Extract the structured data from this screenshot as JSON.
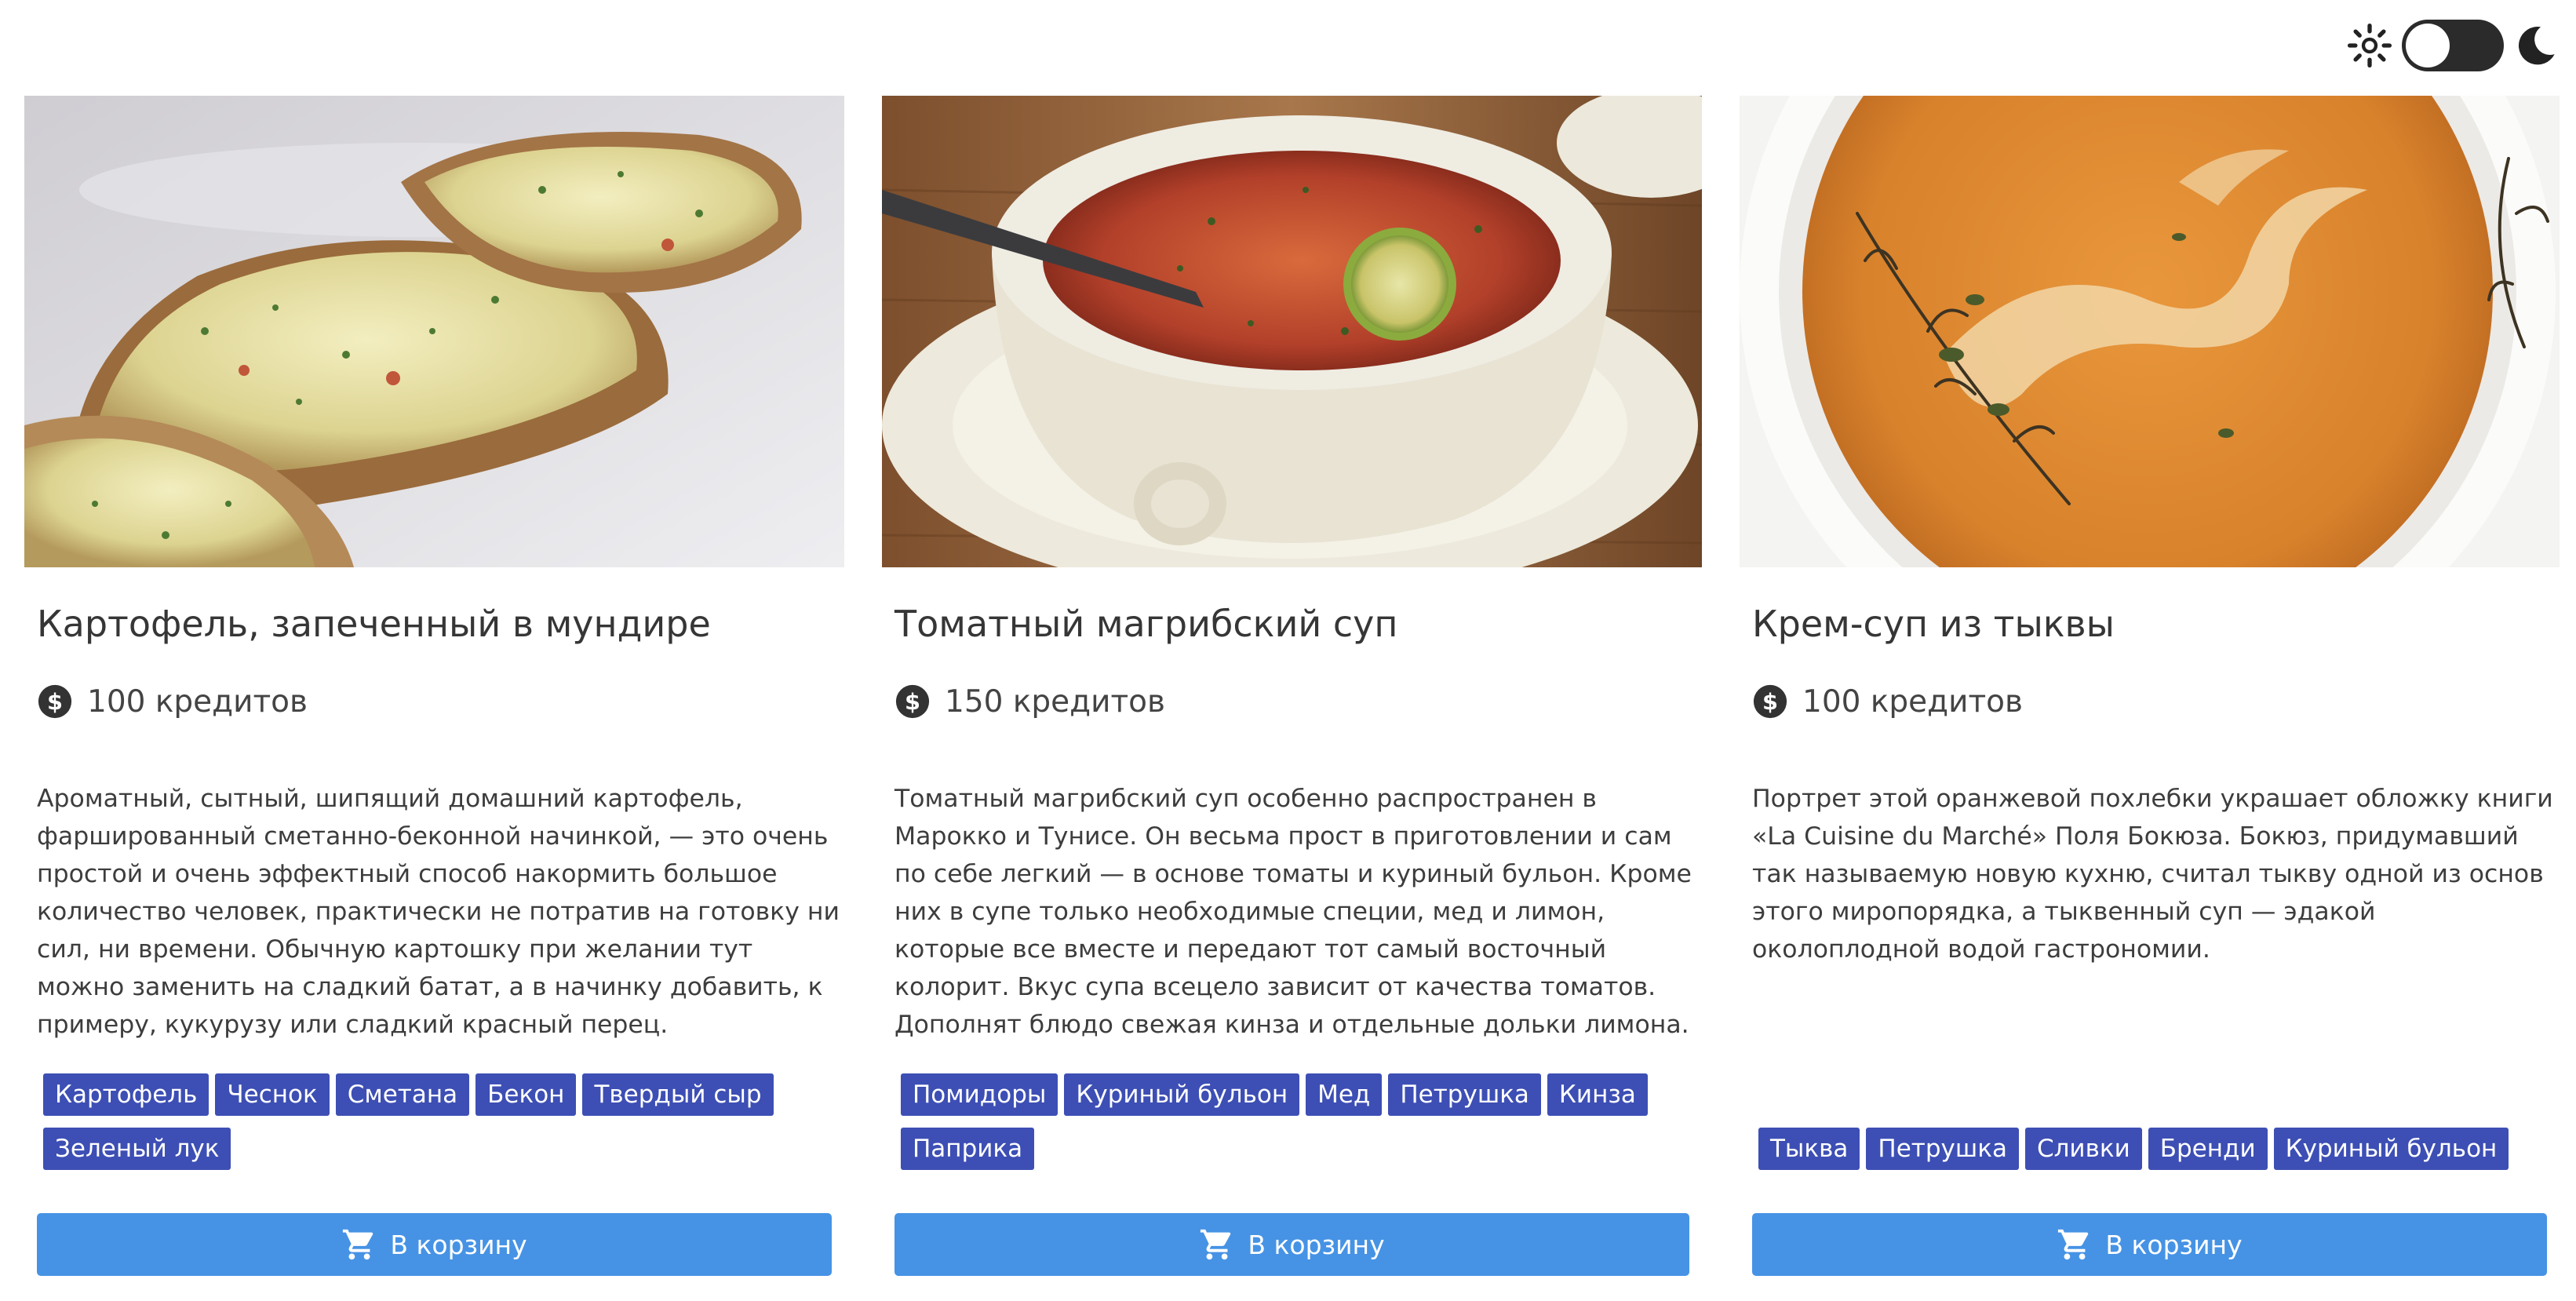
{
  "theme_switch": {
    "light_icon": "sun-icon",
    "dark_icon": "moon-icon",
    "state": "light"
  },
  "currency_icon": "dollar-coin-icon",
  "cart_icon": "shopping-cart-icon",
  "colors": {
    "tag_background": "#3d4fb4",
    "button_background": "#4693e5",
    "toggle_track": "#2b2b2b"
  },
  "cards": [
    {
      "image": "baked-potato-photo",
      "title": "Картофель, запеченный в мундире",
      "price": "100 кредитов",
      "description": "Ароматный, сытный, шипящий домашний картофель, фаршированный сметанно-беконной начинкой, — это очень простой и очень эффектный способ накормить большое количество человек, практически не потратив на готовку ни сил, ни времени. Обычную картошку при желании тут можно заменить на сладкий батат, а в начинку добавить, к примеру, кукурузу или сладкий красный перец.",
      "tags": [
        "Картофель",
        "Чеснок",
        "Сметана",
        "Бекон",
        "Твердый сыр",
        "Зеленый лук"
      ],
      "button_label": "В корзину"
    },
    {
      "image": "tomato-soup-photo",
      "title": "Томатный магрибский суп",
      "price": "150 кредитов",
      "description": "Томатный магрибский суп особенно распространен в Марокко и Тунисе. Он весьма прост в приготовлении и сам по себе легкий — в основе томаты и куриный бульон. Кроме них в супе только необходимые специи, мед и лимон, которые все вместе и передают тот самый восточный колорит. Вкус супа всецело зависит от качества томатов. Дополнят блюдо свежая кинза и отдельные дольки лимона.",
      "tags": [
        "Помидоры",
        "Куриный бульон",
        "Мед",
        "Петрушка",
        "Кинза",
        "Паприка"
      ],
      "button_label": "В корзину"
    },
    {
      "image": "pumpkin-soup-photo",
      "title": "Крем-суп из тыквы",
      "price": "100 кредитов",
      "description": "Портрет этой оранжевой похлебки украшает обложку книги «La Cuisine du Marché» Поля Бокюза. Бокюз, придумавший так называемую новую кухню, считал тыкву одной из основ этого миропорядка, а тыквенный суп — эдакой околоплодной водой гастрономии.",
      "tags": [
        "Тыква",
        "Петрушка",
        "Сливки",
        "Бренди",
        "Куриный бульон"
      ],
      "button_label": "В корзину"
    }
  ]
}
